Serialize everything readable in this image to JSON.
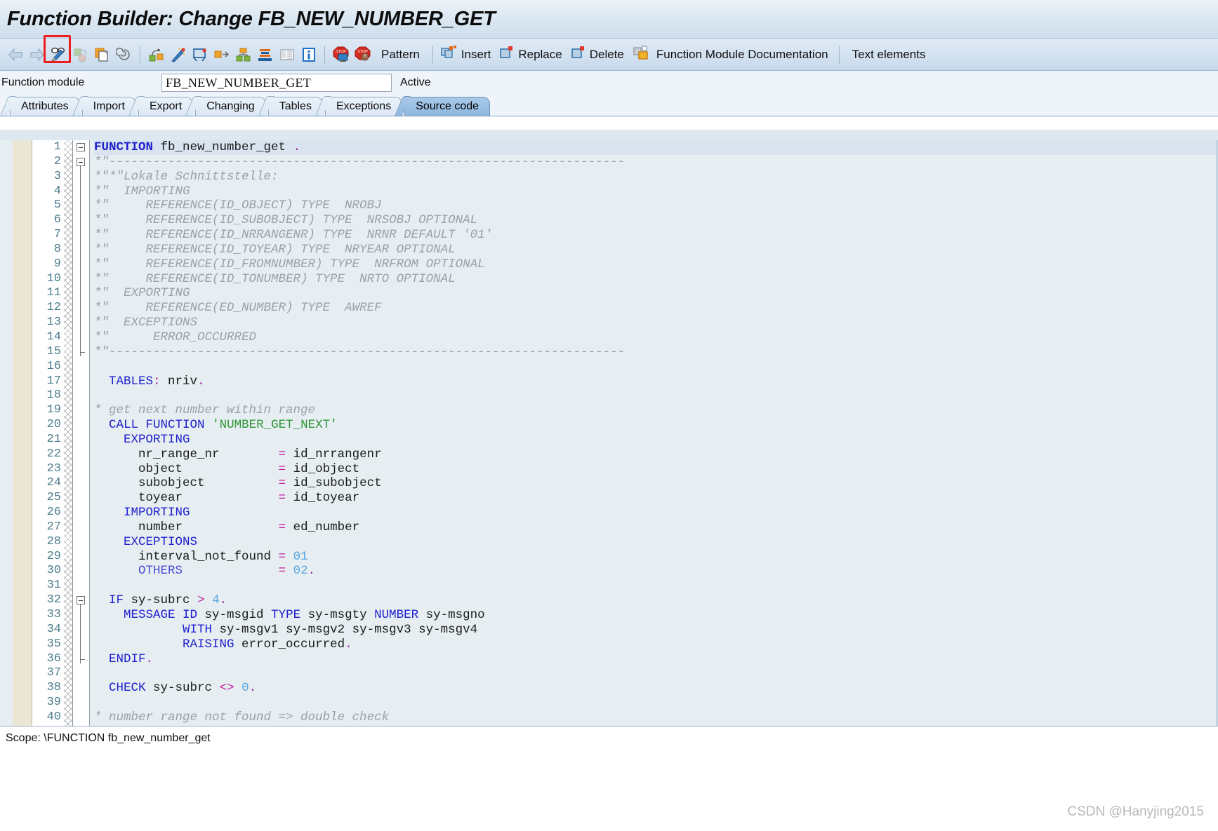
{
  "window": {
    "title": "Function Builder: Change FB_NEW_NUMBER_GET"
  },
  "toolbar": {
    "icons": [
      {
        "name": "back-arrow-icon",
        "glyph": "back"
      },
      {
        "name": "forward-arrow-icon",
        "glyph": "forward"
      },
      {
        "name": "display-change-icon",
        "glyph": "glasses-pencil"
      },
      {
        "name": "check-icon",
        "glyph": "check-disabled"
      },
      {
        "name": "copy-icon",
        "glyph": "copy"
      },
      {
        "name": "where-used-icon",
        "glyph": "spiral"
      },
      {
        "name": "activate-icon",
        "glyph": "activate"
      },
      {
        "name": "pretty-printer-icon",
        "glyph": "wand"
      },
      {
        "name": "display-object-list-icon",
        "glyph": "object-list"
      },
      {
        "name": "navigation-icon",
        "glyph": "navigate"
      },
      {
        "name": "hierarchy-icon",
        "glyph": "hierarchy"
      },
      {
        "name": "layers-icon",
        "glyph": "layers"
      },
      {
        "name": "list-icon",
        "glyph": "list"
      },
      {
        "name": "info-icon",
        "glyph": "info"
      },
      {
        "name": "breakpoint-icon",
        "glyph": "stop-screen"
      },
      {
        "name": "watchpoint-icon",
        "glyph": "stop-user"
      }
    ],
    "pattern_label": "Pattern",
    "insert_icon": "insert-icon",
    "insert_label": "Insert",
    "replace_icon": "replace-icon",
    "replace_label": "Replace",
    "delete_icon": "delete-icon",
    "delete_label": "Delete",
    "documentation_icon": "documentation-icon",
    "documentation_label": "Function Module Documentation",
    "text_elements_label": "Text elements",
    "highlight_color": "#ef1d1d"
  },
  "function_module": {
    "label": "Function module",
    "value": "FB_NEW_NUMBER_GET",
    "placeholder": "",
    "status": "Active"
  },
  "tabs": [
    {
      "label": "Attributes",
      "active": false
    },
    {
      "label": "Import",
      "active": false
    },
    {
      "label": "Export",
      "active": false
    },
    {
      "label": "Changing",
      "active": false
    },
    {
      "label": "Tables",
      "active": false
    },
    {
      "label": "Exceptions",
      "active": false
    },
    {
      "label": "Source code",
      "active": true
    }
  ],
  "editor": {
    "first_line_number": 1,
    "last_line_number": 40,
    "line_numbers": [
      "1",
      "2",
      "3",
      "4",
      "5",
      "6",
      "7",
      "8",
      "9",
      "10",
      "11",
      "12",
      "13",
      "14",
      "15",
      "16",
      "17",
      "18",
      "19",
      "20",
      "21",
      "22",
      "23",
      "24",
      "25",
      "26",
      "27",
      "28",
      "29",
      "30",
      "31",
      "32",
      "33",
      "34",
      "35",
      "36",
      "37",
      "38",
      "39",
      "40"
    ],
    "lines": [
      {
        "n": "1",
        "tokens": [
          {
            "t": "FUNCTION",
            "c": "k b"
          },
          {
            "t": " fb_new_number_get ",
            "c": "id"
          },
          {
            "t": ".",
            "c": "p"
          }
        ]
      },
      {
        "n": "2",
        "tokens": [
          {
            "t": "*\"----------------------------------------------------------------------",
            "c": "cm"
          }
        ]
      },
      {
        "n": "3",
        "tokens": [
          {
            "t": "*\"*\"Lokale Schnittstelle:",
            "c": "cm"
          }
        ]
      },
      {
        "n": "4",
        "tokens": [
          {
            "t": "*\"  IMPORTING",
            "c": "cm"
          }
        ]
      },
      {
        "n": "5",
        "tokens": [
          {
            "t": "*\"     REFERENCE(ID_OBJECT) TYPE  NROBJ",
            "c": "cm"
          }
        ]
      },
      {
        "n": "6",
        "tokens": [
          {
            "t": "*\"     REFERENCE(ID_SUBOBJECT) TYPE  NRSOBJ OPTIONAL",
            "c": "cm"
          }
        ]
      },
      {
        "n": "7",
        "tokens": [
          {
            "t": "*\"     REFERENCE(ID_NRRANGENR) TYPE  NRNR DEFAULT '01'",
            "c": "cm"
          }
        ]
      },
      {
        "n": "8",
        "tokens": [
          {
            "t": "*\"     REFERENCE(ID_TOYEAR) TYPE  NRYEAR OPTIONAL",
            "c": "cm"
          }
        ]
      },
      {
        "n": "9",
        "tokens": [
          {
            "t": "*\"     REFERENCE(ID_FROMNUMBER) TYPE  NRFROM OPTIONAL",
            "c": "cm"
          }
        ]
      },
      {
        "n": "10",
        "tokens": [
          {
            "t": "*\"     REFERENCE(ID_TONUMBER) TYPE  NRTO OPTIONAL",
            "c": "cm"
          }
        ]
      },
      {
        "n": "11",
        "tokens": [
          {
            "t": "*\"  EXPORTING",
            "c": "cm"
          }
        ]
      },
      {
        "n": "12",
        "tokens": [
          {
            "t": "*\"     REFERENCE(ED_NUMBER) TYPE  AWREF",
            "c": "cm"
          }
        ]
      },
      {
        "n": "13",
        "tokens": [
          {
            "t": "*\"  EXCEPTIONS",
            "c": "cm"
          }
        ]
      },
      {
        "n": "14",
        "tokens": [
          {
            "t": "*\"      ERROR_OCCURRED",
            "c": "cm"
          }
        ]
      },
      {
        "n": "15",
        "tokens": [
          {
            "t": "*\"----------------------------------------------------------------------",
            "c": "cm"
          }
        ]
      },
      {
        "n": "16",
        "tokens": []
      },
      {
        "n": "17",
        "tokens": [
          {
            "t": "  ",
            "c": "id"
          },
          {
            "t": "TABLES",
            "c": "k"
          },
          {
            "t": ":",
            "c": "p"
          },
          {
            "t": " nriv",
            "c": "id"
          },
          {
            "t": ".",
            "c": "p"
          }
        ]
      },
      {
        "n": "18",
        "tokens": []
      },
      {
        "n": "19",
        "tokens": [
          {
            "t": "* get next number within range",
            "c": "cm"
          }
        ]
      },
      {
        "n": "20",
        "tokens": [
          {
            "t": "  ",
            "c": "id"
          },
          {
            "t": "CALL FUNCTION",
            "c": "k"
          },
          {
            "t": " ",
            "c": "id"
          },
          {
            "t": "'NUMBER_GET_NEXT'",
            "c": "s"
          }
        ]
      },
      {
        "n": "21",
        "tokens": [
          {
            "t": "    ",
            "c": "id"
          },
          {
            "t": "EXPORTING",
            "c": "k"
          }
        ]
      },
      {
        "n": "22",
        "tokens": [
          {
            "t": "      nr_range_nr        ",
            "c": "id"
          },
          {
            "t": "=",
            "c": "o"
          },
          {
            "t": " id_nrrangenr",
            "c": "id"
          }
        ]
      },
      {
        "n": "23",
        "tokens": [
          {
            "t": "      object             ",
            "c": "id"
          },
          {
            "t": "=",
            "c": "o"
          },
          {
            "t": " id_object",
            "c": "id"
          }
        ]
      },
      {
        "n": "24",
        "tokens": [
          {
            "t": "      subobject          ",
            "c": "id"
          },
          {
            "t": "=",
            "c": "o"
          },
          {
            "t": " id_subobject",
            "c": "id"
          }
        ]
      },
      {
        "n": "25",
        "tokens": [
          {
            "t": "      toyear             ",
            "c": "id"
          },
          {
            "t": "=",
            "c": "o"
          },
          {
            "t": " id_toyear",
            "c": "id"
          }
        ]
      },
      {
        "n": "26",
        "tokens": [
          {
            "t": "    ",
            "c": "id"
          },
          {
            "t": "IMPORTING",
            "c": "k"
          }
        ]
      },
      {
        "n": "27",
        "tokens": [
          {
            "t": "      number             ",
            "c": "id"
          },
          {
            "t": "=",
            "c": "o"
          },
          {
            "t": " ed_number",
            "c": "id"
          }
        ]
      },
      {
        "n": "28",
        "tokens": [
          {
            "t": "    ",
            "c": "id"
          },
          {
            "t": "EXCEPTIONS",
            "c": "k"
          }
        ]
      },
      {
        "n": "29",
        "tokens": [
          {
            "t": "      interval_not_found ",
            "c": "id"
          },
          {
            "t": "=",
            "c": "o"
          },
          {
            "t": " ",
            "c": "id"
          },
          {
            "t": "01",
            "c": "n"
          }
        ]
      },
      {
        "n": "30",
        "tokens": [
          {
            "t": "      ",
            "c": "id"
          },
          {
            "t": "OTHERS",
            "c": "kp"
          },
          {
            "t": "             ",
            "c": "id"
          },
          {
            "t": "=",
            "c": "o"
          },
          {
            "t": " ",
            "c": "id"
          },
          {
            "t": "02",
            "c": "n"
          },
          {
            "t": ".",
            "c": "p"
          }
        ]
      },
      {
        "n": "31",
        "tokens": []
      },
      {
        "n": "32",
        "tokens": [
          {
            "t": "  ",
            "c": "id"
          },
          {
            "t": "IF",
            "c": "k"
          },
          {
            "t": " sy-subrc ",
            "c": "id"
          },
          {
            "t": ">",
            "c": "o"
          },
          {
            "t": " ",
            "c": "id"
          },
          {
            "t": "4",
            "c": "n"
          },
          {
            "t": ".",
            "c": "p"
          }
        ]
      },
      {
        "n": "33",
        "tokens": [
          {
            "t": "    ",
            "c": "id"
          },
          {
            "t": "MESSAGE ID",
            "c": "k"
          },
          {
            "t": " sy-msgid ",
            "c": "id"
          },
          {
            "t": "TYPE",
            "c": "k"
          },
          {
            "t": " sy-msgty ",
            "c": "id"
          },
          {
            "t": "NUMBER",
            "c": "k"
          },
          {
            "t": " sy-msgno",
            "c": "id"
          }
        ]
      },
      {
        "n": "34",
        "tokens": [
          {
            "t": "            ",
            "c": "id"
          },
          {
            "t": "WITH",
            "c": "k"
          },
          {
            "t": " sy-msgv1 sy-msgv2 sy-msgv3 sy-msgv4",
            "c": "id"
          }
        ]
      },
      {
        "n": "35",
        "tokens": [
          {
            "t": "            ",
            "c": "id"
          },
          {
            "t": "RAISING",
            "c": "k"
          },
          {
            "t": " error_occurred",
            "c": "id"
          },
          {
            "t": ".",
            "c": "p"
          }
        ]
      },
      {
        "n": "36",
        "tokens": [
          {
            "t": "  ",
            "c": "id"
          },
          {
            "t": "ENDIF",
            "c": "k"
          },
          {
            "t": ".",
            "c": "p"
          }
        ]
      },
      {
        "n": "37",
        "tokens": []
      },
      {
        "n": "38",
        "tokens": [
          {
            "t": "  ",
            "c": "id"
          },
          {
            "t": "CHECK",
            "c": "k"
          },
          {
            "t": " sy-subrc ",
            "c": "id"
          },
          {
            "t": "<>",
            "c": "o"
          },
          {
            "t": " ",
            "c": "id"
          },
          {
            "t": "0",
            "c": "n"
          },
          {
            "t": ".",
            "c": "p"
          }
        ]
      },
      {
        "n": "39",
        "tokens": []
      },
      {
        "n": "40",
        "tokens": [
          {
            "t": "* number range not found => double check",
            "c": "cm"
          }
        ]
      }
    ]
  },
  "statusbar": {
    "scope": "Scope: \\FUNCTION fb_new_number_get"
  },
  "watermark": {
    "text": "CSDN @Hanyjing2015",
    "overlay": "ABAP"
  },
  "colors": {
    "accent": "#2020cd",
    "string": "#2f9636",
    "comment": "#9aa2a8",
    "number": "#57a6e0",
    "highlight": "#ef1d1d",
    "editor_bg": "#e6eef2"
  }
}
